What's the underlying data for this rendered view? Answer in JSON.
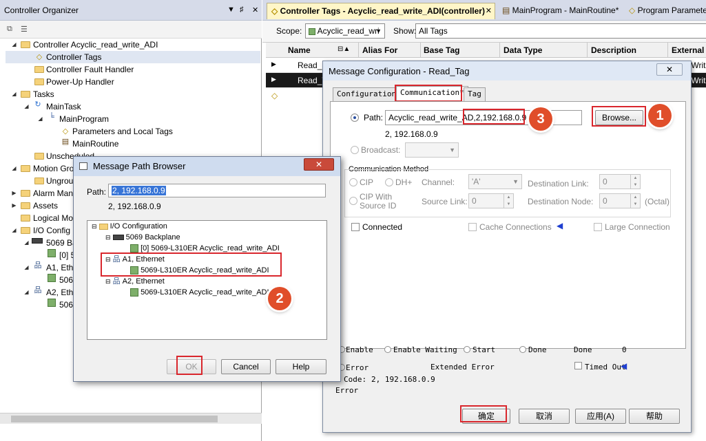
{
  "organizer": {
    "title": "Controller Organizer",
    "title_buttons": [
      "▼",
      "♯",
      "✕"
    ],
    "tree": [
      {
        "label": "Controller Acyclic_read_write_ADI",
        "icon": "folder-icon"
      },
      {
        "label": "Controller Tags",
        "icon": "tag-icon"
      },
      {
        "label": "Controller Fault Handler",
        "icon": "folder-icon"
      },
      {
        "label": "Power-Up Handler",
        "icon": "folder-icon"
      },
      {
        "label": "Tasks",
        "icon": "folder-icon"
      },
      {
        "label": "MainTask",
        "icon": "task-icon"
      },
      {
        "label": "MainProgram",
        "icon": "program-icon"
      },
      {
        "label": "Parameters and Local Tags",
        "icon": "tag-icon"
      },
      {
        "label": "MainRoutine",
        "icon": "routine-icon"
      },
      {
        "label": "Unscheduled",
        "icon": "folder-icon"
      },
      {
        "label": "Motion Gro",
        "icon": "folder-icon"
      },
      {
        "label": "Ungrou",
        "icon": "folder-icon"
      },
      {
        "label": "Alarm Man",
        "icon": "folder-icon"
      },
      {
        "label": "Assets",
        "icon": "folder-icon"
      },
      {
        "label": "Logical Mo",
        "icon": "folder-icon"
      },
      {
        "label": "I/O Config",
        "icon": "folder-icon"
      },
      {
        "label": "5069 Ba",
        "icon": "backplane-icon"
      },
      {
        "label": "[0] 5",
        "icon": "controller-icon"
      },
      {
        "label": "A1, Ethe",
        "icon": "network-icon"
      },
      {
        "label": "5069",
        "icon": "controller-icon"
      },
      {
        "label": "A2, Ethe",
        "icon": "network-icon"
      },
      {
        "label": "5069",
        "icon": "controller-icon"
      }
    ]
  },
  "tabs": [
    {
      "label": "Controller Tags - Acyclic_read_write_ADI(controller)",
      "close": "✕"
    },
    {
      "label": "MainProgram - MainRoutine*"
    },
    {
      "label": "Program Paramete"
    }
  ],
  "scope": {
    "scope_label": "Scope:",
    "scope_value": "Acyclic_read_wri",
    "show_label": "Show:",
    "show_value": "All Tags"
  },
  "grid": {
    "columns": [
      "Name",
      "Alias For",
      "Base Tag",
      "Data Type",
      "Description",
      "External A"
    ],
    "rows": [
      {
        "name": "Read_D",
        "tail": "/Writ"
      },
      {
        "name": "Read_T",
        "tail": "/Writ"
      }
    ]
  },
  "msg_config": {
    "title": "Message Configuration - Read_Tag",
    "close": "✕",
    "tabs": [
      "Configuration",
      "Communication*",
      "Tag"
    ],
    "path_label": "Path:",
    "path_value": "Acyclic_read_write_AD",
    "path_suffix": ",2,192.168.0.9",
    "path_display": "2, 192.168.0.9",
    "browse": "Browse...",
    "broadcast_label": "Broadcast:",
    "comm_method_label": "Communication Method",
    "cip": "CIP",
    "dhplus": "DH+",
    "channel_label": "Channel:",
    "channel_value": "'A'",
    "dest_link_label": "Destination Link:",
    "dest_link_value": "0",
    "cip_with_source_id": "CIP With\nSource ID",
    "source_link_label": "Source Link:",
    "source_link_value": "0",
    "dest_node_label": "Destination Node:",
    "dest_node_value": "0",
    "octal": "(Octal)",
    "connected": "Connected",
    "cache_connections": "Cache Connections",
    "large_connection": "Large Connection",
    "status": {
      "enable": "Enable",
      "enable_waiting": "Enable Waiting",
      "start": "Start",
      "done": "Done",
      "done_length_label": "Done",
      "done_length_value": "0",
      "error": "Error",
      "extended_error": "Extended Error",
      "timed_out": "Timed Out",
      "error_code_label": "Code:",
      "error_code_value": "2, 192.168.0.9",
      "error_path": "Error"
    },
    "buttons": {
      "ok": "确定",
      "cancel": "取消",
      "apply": "应用(A)",
      "help": "帮助"
    }
  },
  "path_browser": {
    "title": "Message Path Browser",
    "close": "✕",
    "path_label": "Path:",
    "path_value": "2, 192.168.0.9",
    "path_display": "2, 192.168.0.9",
    "tree": [
      {
        "label": "I/O Configuration"
      },
      {
        "label": "5069 Backplane"
      },
      {
        "label": "[0] 5069-L310ER Acyclic_read_write_ADI"
      },
      {
        "label": "A1, Ethernet"
      },
      {
        "label": "5069-L310ER Acyclic_read_write_ADI"
      },
      {
        "label": "A2, Ethernet"
      },
      {
        "label": "5069-L310ER Acyclic_read_write_ADI"
      }
    ],
    "buttons": {
      "ok": "OK",
      "cancel": "Cancel",
      "help": "Help"
    }
  },
  "annotations": {
    "step1": "1",
    "step2": "2",
    "step3": "3"
  },
  "colors": {
    "highlight": "#d9262c",
    "badge": "#e04e2a",
    "title_bg": "#d6dbe9",
    "active_tab": "#fff6c8"
  }
}
